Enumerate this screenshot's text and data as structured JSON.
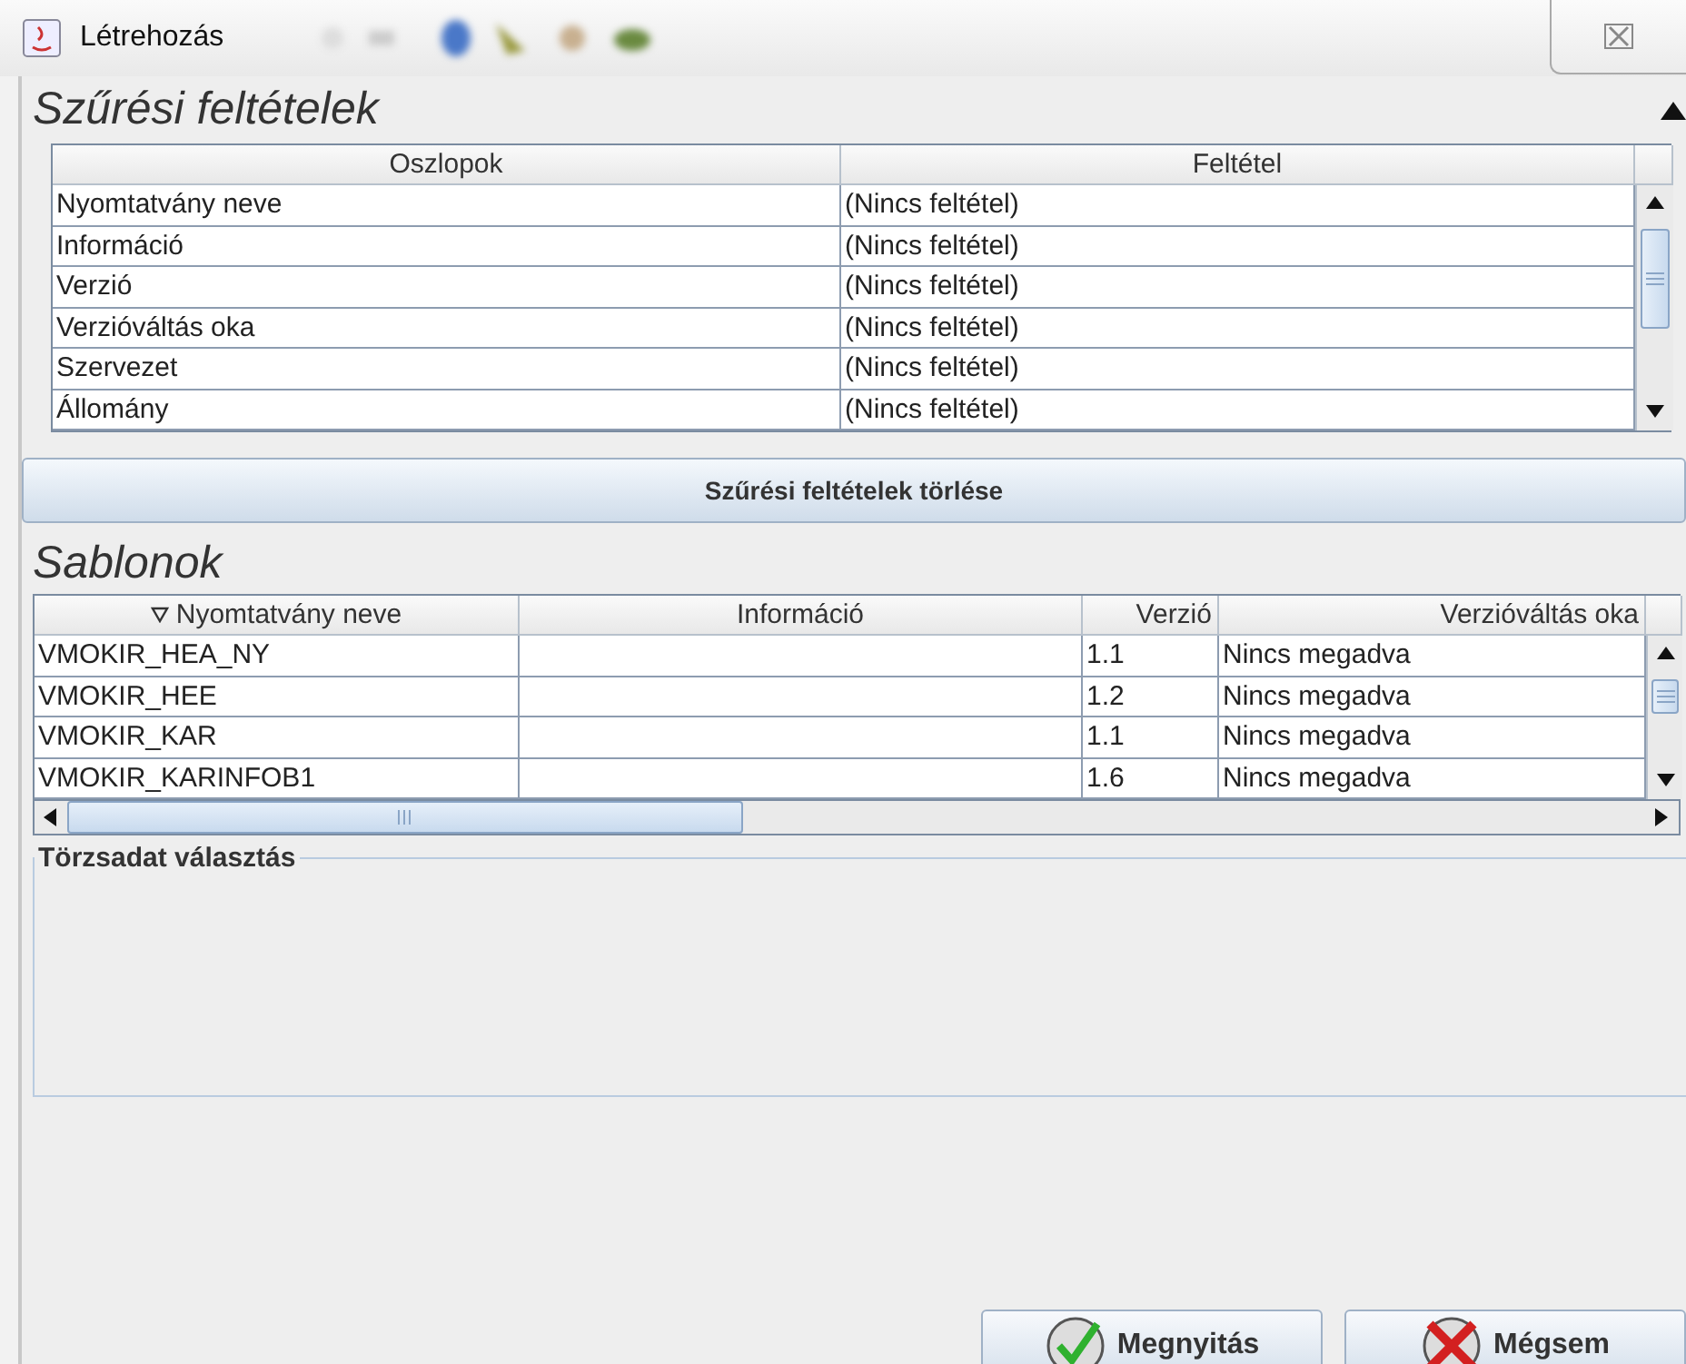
{
  "window": {
    "title": "Létrehozás"
  },
  "filter_section": {
    "title": "Szűrési feltételek",
    "expanded": true,
    "columns": [
      "Oszlopok",
      "Feltétel"
    ],
    "rows": [
      [
        "Nyomtatvány neve",
        "(Nincs feltétel)"
      ],
      [
        "Információ",
        "(Nincs feltétel)"
      ],
      [
        "Verzió",
        "(Nincs feltétel)"
      ],
      [
        "Verzióváltás oka",
        "(Nincs feltétel)"
      ],
      [
        "Szervezet",
        "(Nincs feltétel)"
      ],
      [
        "Állomány",
        "(Nincs feltétel)"
      ]
    ],
    "clear_button": "Szűrési feltételek törlése"
  },
  "templates_section": {
    "title": "Sablonok",
    "columns": [
      {
        "label": "Nyomtatvány neve",
        "sorted": true
      },
      {
        "label": "Információ",
        "sorted": false
      },
      {
        "label": "Verzió",
        "sorted": false
      },
      {
        "label": "Verzióváltás oka",
        "sorted": false
      }
    ],
    "rows": [
      [
        "VMOKIR_HEA_NY",
        "",
        "1.1",
        "Nincs megadva"
      ],
      [
        "VMOKIR_HEE",
        "",
        "1.2",
        "Nincs megadva"
      ],
      [
        "VMOKIR_KAR",
        "",
        "1.1",
        "Nincs megadva"
      ],
      [
        "VMOKIR_KARINFOB1",
        "",
        "1.6",
        "Nincs megadva"
      ]
    ]
  },
  "master_data": {
    "legend": "Törzsadat választás"
  },
  "buttons": [
    {
      "kind": "ok",
      "label": "Megnyitás"
    },
    {
      "kind": "cancel",
      "label": "Mégsem"
    }
  ]
}
